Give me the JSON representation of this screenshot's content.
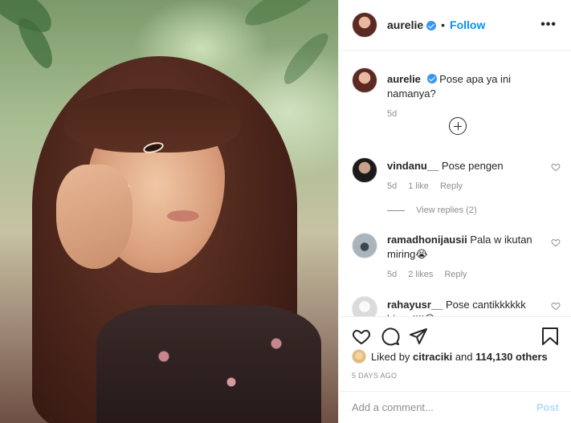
{
  "post": {
    "username": "aurelie",
    "follow_label": "Follow",
    "dot": "•",
    "more_label": "•••"
  },
  "caption": {
    "username": "aurelie",
    "text": "Pose apa ya ini namanya?",
    "time": "5d"
  },
  "comments": [
    {
      "username": "vindanu__",
      "text": "Pose pengen",
      "time": "5d",
      "likes": "1 like",
      "reply_label": "Reply",
      "view_replies": "View replies (2)"
    },
    {
      "username": "ramadhonijausii",
      "text": "Pala w ikutan miring😭",
      "time": "5d",
      "likes": "2 likes",
      "reply_label": "Reply"
    },
    {
      "username": "rahayusr__",
      "text": "Pose cantikkkkkk bi......!!!!😍",
      "time": "",
      "likes": "",
      "reply_label": ""
    }
  ],
  "likes": {
    "prefix": "Liked by",
    "user": "citraciki",
    "middle": "and",
    "count": "114,130 others"
  },
  "posted_ago": "5 DAYS AGO",
  "add_comment": {
    "placeholder": "Add a comment...",
    "post_label": "Post"
  },
  "colors": {
    "link_blue": "#0095f6",
    "verified_blue": "#3897f0",
    "muted": "#8e8e8e",
    "post_disabled": "#b3dbff"
  }
}
